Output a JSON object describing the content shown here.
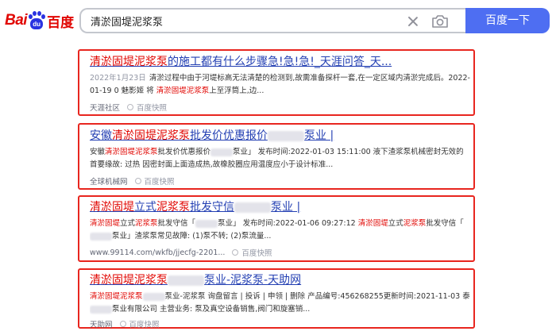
{
  "header": {
    "logo": {
      "latin_a": "Bai",
      "latin_b": "du",
      "cn": "百度"
    },
    "search": {
      "value": "清淤固堤泥浆泵",
      "placeholder": ""
    },
    "search_button": "百度一下",
    "icons": {
      "clear": "close-icon",
      "camera": "camera-icon"
    }
  },
  "results": [
    {
      "title_hl": "清淤固堤泥浆泵",
      "title_rest": "的施工都有什么步骤急!急!急!_天涯问答_天...",
      "date": "2022年1月23日",
      "abstract_a": "清淤过程中由于河堤标高无法清楚的检测到,故需准备探杆一套,在一定区域内清淤完成后。",
      "abstract_hl": "清淤固堤泥浆泵",
      "abstract_b": "2022-01-19 0 魅影姬 将",
      "abstract_c": "上至浮筒上,边...",
      "source": "天涯社区",
      "snapshot": "百度快照"
    },
    {
      "title_a": "安徽",
      "title_hl": "清淤固堤泥浆泵",
      "title_b": "批发价优惠报价",
      "title_c": "泵业 |",
      "abstract_a": "安徽",
      "abstract_hl": "清淤固堤泥浆泵",
      "abstract_b": "批发价优惠报价",
      "abstract_c": "泵业」 发布时间:2022-01-03 15:11:00 液下渣浆泵机械密封无效的首要缘故: 过热 因密封面上面造成热,故橡胶圈应用温度应小于设计标准...",
      "source": "全球机械网",
      "snapshot": "百度快照"
    },
    {
      "title_hl_a": "清淤固堤",
      "title_a": "立式",
      "title_hl_b": "泥浆泵",
      "title_b": "批发守信",
      "title_c": "泵业 |",
      "abstract_hl_a": "清淤固堤",
      "abstract_a": "立式",
      "abstract_hl_b": "泥浆泵",
      "abstract_b": "批发守信「",
      "abstract_c": "泵业」 发布时间:2022-01-06 09:27:12",
      "abstract_hl_c": "清淤固堤",
      "abstract_d": "立式",
      "abstract_hl_d": "泥浆泵",
      "abstract_e": "批发守信「",
      "abstract_f": "泵业」渣浆泵常见故障: (1)泵不转; (2)泵流量...",
      "source": "www.99114.com/wkfb/jjecfg-2201...",
      "snapshot": "百度快照"
    },
    {
      "title_hl": "清淤固堤泥浆泵",
      "title_rest": "泵业-泥浆泵-天助网",
      "abstract_hl": "清淤固堤泥浆泵",
      "abstract_a": "泵业-泥浆泵 询盘留言 | 投诉 | 申领 | 删除 产品编号:456268255更新时间:2021-11-03 泰",
      "abstract_b": "泵业有限公司 主营业务: 泵及真空设备销售,阀门和旋塞销...",
      "source": "天助网",
      "snapshot": "百度快照"
    }
  ]
}
